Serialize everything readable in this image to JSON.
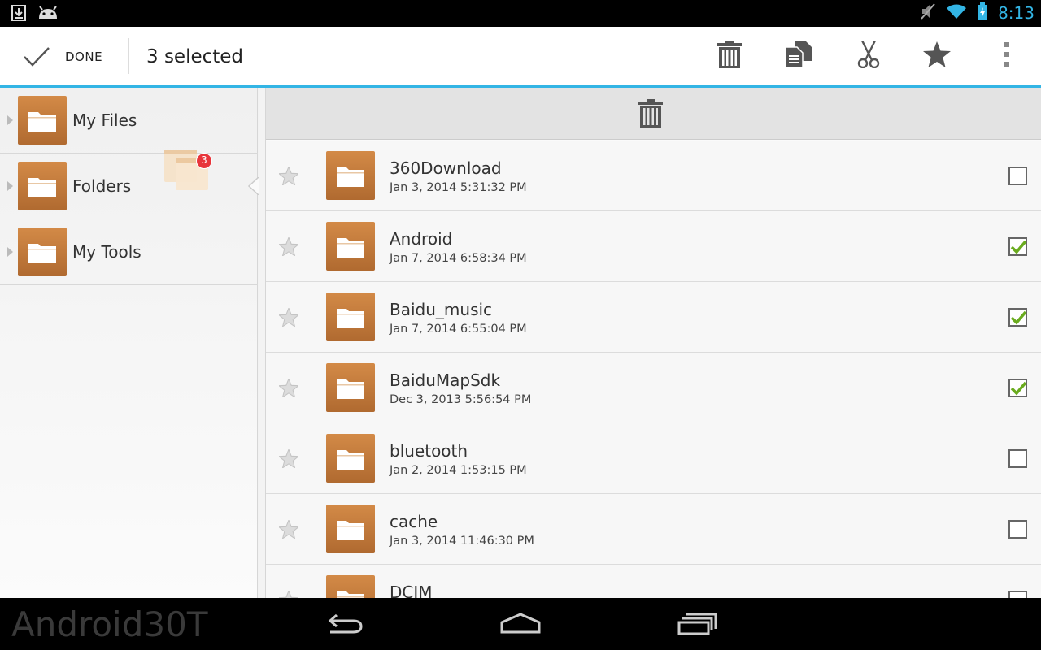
{
  "status": {
    "time": "8:13"
  },
  "action_bar": {
    "done_label": "DONE",
    "selected_label": "3  selected",
    "actions": [
      "trash-icon",
      "copy-icon",
      "cut-icon",
      "star-icon",
      "overflow-icon"
    ]
  },
  "sidebar": {
    "items": [
      {
        "label": "My Files",
        "icon": "folder-icon"
      },
      {
        "label": "Folders",
        "icon": "folder-icon"
      },
      {
        "label": "My Tools",
        "icon": "folder-icon"
      }
    ]
  },
  "drag": {
    "count": "3"
  },
  "files": [
    {
      "name": "360Download",
      "date": "Jan 3, 2014 5:31:32 PM",
      "checked": false
    },
    {
      "name": "Android",
      "date": "Jan 7, 2014 6:58:34 PM",
      "checked": true
    },
    {
      "name": "Baidu_music",
      "date": "Jan 7, 2014 6:55:04 PM",
      "checked": true
    },
    {
      "name": "BaiduMapSdk",
      "date": "Dec 3, 2013 5:56:54 PM",
      "checked": true
    },
    {
      "name": "bluetooth",
      "date": "Jan 2, 2014 1:53:15 PM",
      "checked": false
    },
    {
      "name": "cache",
      "date": "Jan 3, 2014 11:46:30 PM",
      "checked": false
    },
    {
      "name": "DCIM",
      "date": "",
      "checked": false
    }
  ],
  "nav": {
    "brand": "Android30T"
  },
  "colors": {
    "accent": "#33b5e5",
    "folder": "#c57a3d",
    "check": "#6aab1e"
  }
}
